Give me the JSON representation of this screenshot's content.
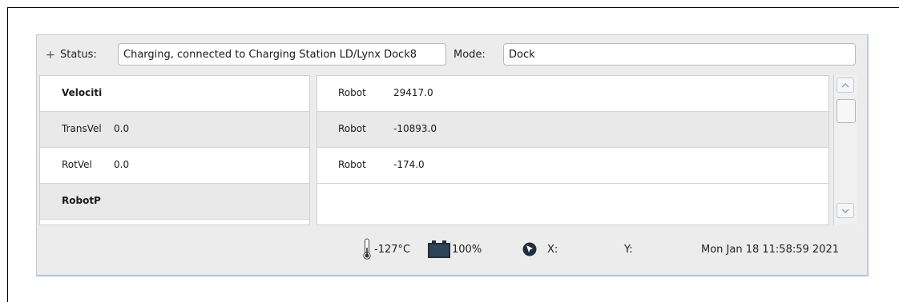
{
  "status": {
    "expand_symbol": "+",
    "status_label": "Status:",
    "status_value": "Charging, connected to Charging Station LD/Lynx Dock8",
    "mode_label": "Mode:",
    "mode_value": "Dock"
  },
  "left_table": {
    "rows": [
      {
        "name": "Velociti",
        "value": "",
        "header": true
      },
      {
        "name": "TransVel",
        "value": "0.0"
      },
      {
        "name": "RotVel",
        "value": "0.0"
      },
      {
        "name": "RobotP",
        "value": "",
        "header": true
      }
    ]
  },
  "right_table": {
    "rows": [
      {
        "name": "Robot",
        "value": "29417.0"
      },
      {
        "name": "Robot",
        "value": "-10893.0"
      },
      {
        "name": "Robot",
        "value": "-174.0"
      },
      {
        "name": "",
        "value": ""
      }
    ]
  },
  "scrollbar": {
    "up_icon": "chevron-up-icon",
    "down_icon": "chevron-down-icon"
  },
  "footer": {
    "temperature": "-127°C",
    "battery": "100%",
    "x_label": "X:",
    "y_label": "Y:",
    "datetime": "Mon Jan 18 11:58:59 2021",
    "icons": [
      "thermometer-icon",
      "battery-icon",
      "cursor-icon"
    ]
  },
  "colors": {
    "panel_bg": "#ececec",
    "border_accent": "#b5cde4",
    "icon_dark": "#1f2f3f"
  }
}
